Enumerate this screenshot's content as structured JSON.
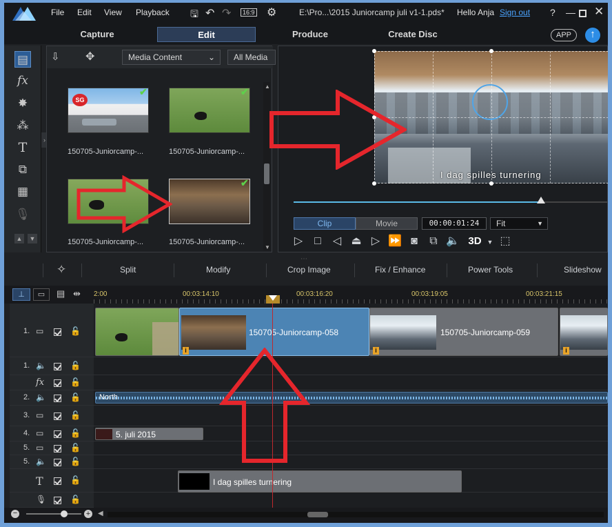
{
  "titlebar": {
    "menu": [
      "File",
      "Edit",
      "View",
      "Playback"
    ],
    "filename": "E:\\Pro...\\2015 Juniorcamp juli v1-1.pds*",
    "greeting": "Hello Anja",
    "signout": "Sign out",
    "aspect": "16:9",
    "help": "?"
  },
  "modes": [
    "Capture",
    "Edit",
    "Produce",
    "Create Disc"
  ],
  "app_button": "APP",
  "library": {
    "dropdown1": "Media Content",
    "dropdown2": "All Media",
    "items": [
      {
        "label": "150705-Juniorcamp-..."
      },
      {
        "label": "150705-Juniorcamp-..."
      },
      {
        "label": "150705-Juniorcamp-..."
      },
      {
        "label": "150705-Juniorcamp-..."
      }
    ]
  },
  "preview": {
    "overlay_text": "I dag spilles turnering",
    "clip_tab": "Clip",
    "movie_tab": "Movie",
    "timecode": "00:00:01:24",
    "fit": "Fit",
    "progress": 0.79,
    "three_d": "3D"
  },
  "editbar": [
    "Split",
    "Modify",
    "Crop Image",
    "Fix / Enhance",
    "Power Tools",
    "Slideshow"
  ],
  "ruler": [
    "2:00",
    "00:03:14:10",
    "00:03:16:20",
    "00:03:19:05",
    "00:03:21:15"
  ],
  "tracks": [
    {
      "label": "1.",
      "kind": "video"
    },
    {
      "label": "1.",
      "kind": "audio"
    },
    {
      "label": "fx",
      "kind": "fx"
    },
    {
      "label": "2.",
      "kind": "audio"
    },
    {
      "label": "3.",
      "kind": "video"
    },
    {
      "label": "4.",
      "kind": "video"
    },
    {
      "label": "5.",
      "kind": "video"
    },
    {
      "label": "5.",
      "kind": "audio"
    },
    {
      "label": "T",
      "kind": "title"
    },
    {
      "label": "",
      "kind": "voice"
    }
  ],
  "clips": {
    "video1_a": "150705-Juniorcamp-058",
    "video1_b": "150705-Juniorcamp-059",
    "audio2": "North",
    "video4": "5. juli 2015",
    "title": "I dag spilles turnering"
  },
  "colors": {
    "accent": "#4aa3ff",
    "selected_clip": "#4c84b4",
    "arrow": "#e5262c",
    "check": "#5ed14b"
  }
}
